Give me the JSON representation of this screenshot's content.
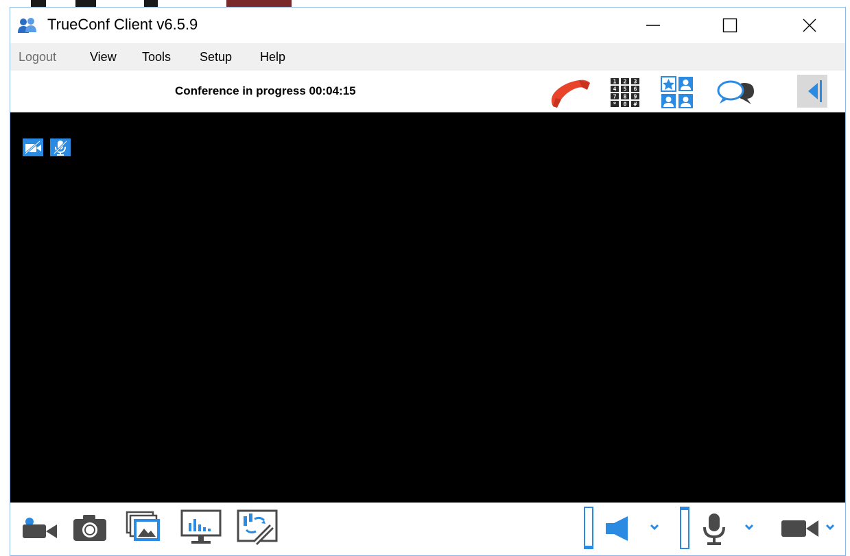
{
  "window": {
    "title": "TrueConf Client v6.5.9",
    "app_icon": "users-icon",
    "controls": [
      "minimize-icon",
      "maximize-icon",
      "close-icon"
    ]
  },
  "menu": {
    "items": [
      {
        "label": "Logout",
        "disabled": true
      },
      {
        "label": "View",
        "disabled": false
      },
      {
        "label": "Tools",
        "disabled": false
      },
      {
        "label": "Setup",
        "disabled": false
      },
      {
        "label": "Help",
        "disabled": false
      }
    ]
  },
  "toolbar": {
    "status": "Conference in progress 00:04:15",
    "icons": [
      "hangup-phone-icon",
      "dialpad-icon",
      "contacts-grid-icon",
      "chat-bubbles-icon",
      "collapse-panel-arrow-icon"
    ],
    "dialpad_keys": [
      "1",
      "2",
      "3",
      "4",
      "5",
      "6",
      "7",
      "8",
      "9",
      "*",
      "0",
      "#"
    ]
  },
  "video": {
    "status_icons": [
      "camera-off-icon",
      "microphone-off-icon"
    ]
  },
  "bottom_bar": {
    "left_icons": [
      "camera-toggle-icon",
      "snapshot-icon",
      "slideshow-icon",
      "share-screen-icon",
      "whiteboard-icon"
    ],
    "right_icons": [
      "speaker-icon",
      "microphone-icon",
      "camera-icon"
    ],
    "volume_level": 0,
    "mic_level": 0
  },
  "colors": {
    "accent": "#2b8be2",
    "hangup": "#e8432b",
    "icon_gray": "#4a4a4a"
  }
}
